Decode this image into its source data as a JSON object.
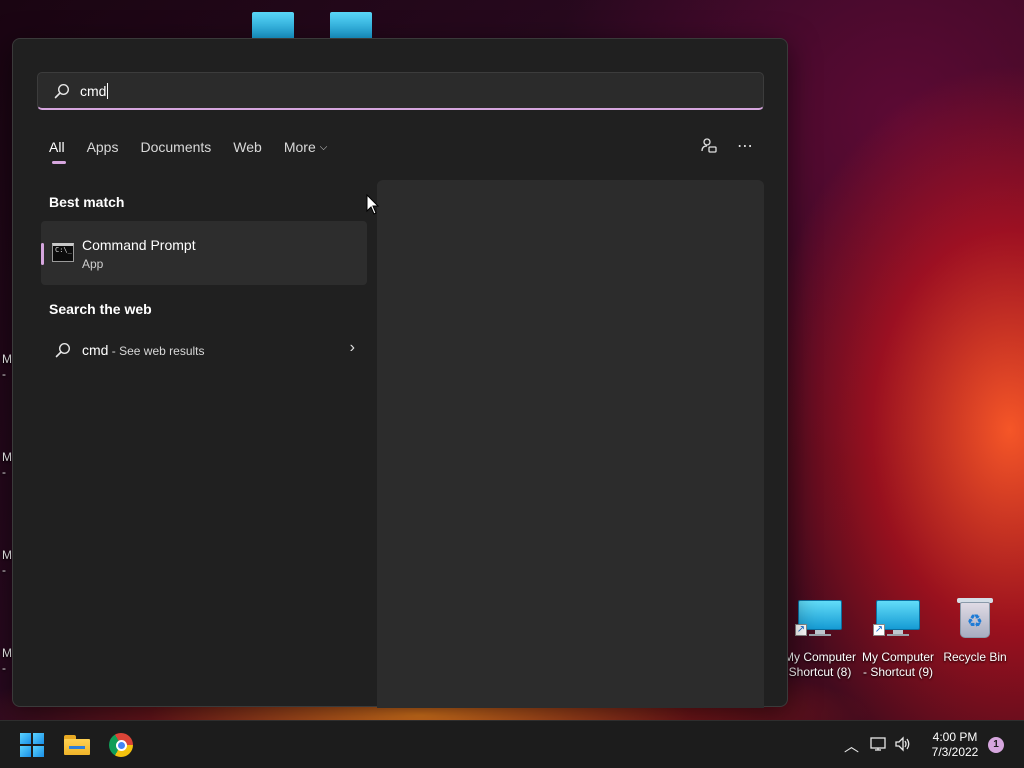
{
  "desktop": {
    "left_labels": [
      "M",
      "-",
      "M",
      "-",
      "M",
      "-",
      "M",
      "-"
    ],
    "icons": [
      {
        "label_line1": "My Computer",
        "label_line2": "Shortcut (8)"
      },
      {
        "label_line1": "My Computer",
        "label_line2": "- Shortcut (9)"
      },
      {
        "label_line1": "Recycle Bin",
        "label_line2": ""
      }
    ]
  },
  "search": {
    "query": "cmd",
    "tabs": [
      "All",
      "Apps",
      "Documents",
      "Web",
      "More"
    ],
    "active_tab": "All",
    "best_match_heading": "Best match",
    "best_match": {
      "title": "Command Prompt",
      "subtitle": "App"
    },
    "web_heading": "Search the web",
    "web_result": {
      "query": "cmd",
      "suffix": " - See web results"
    }
  },
  "taskbar": {
    "time": "4:00 PM",
    "date": "7/3/2022",
    "notification_count": "1"
  },
  "colors": {
    "accent": "#d6a6de",
    "panel_bg": "#202020",
    "taskbar_bg": "#1c1c1c"
  }
}
